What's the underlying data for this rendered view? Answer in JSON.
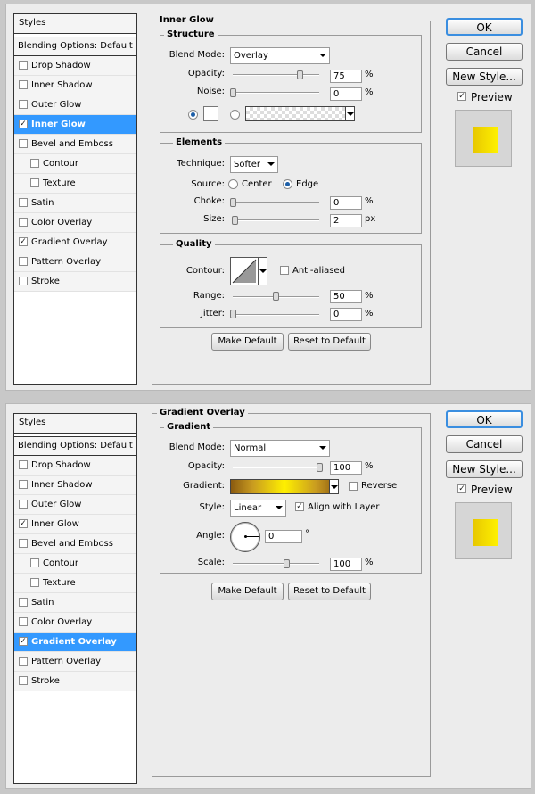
{
  "styles_list": {
    "header": "Styles",
    "blending": "Blending Options: Default",
    "items": [
      "Drop Shadow",
      "Inner Shadow",
      "Outer Glow",
      "Inner Glow",
      "Bevel and Emboss",
      "Contour",
      "Texture",
      "Satin",
      "Color Overlay",
      "Gradient Overlay",
      "Pattern Overlay",
      "Stroke"
    ]
  },
  "buttons": {
    "ok": "OK",
    "cancel": "Cancel",
    "new_style": "New Style...",
    "preview": "Preview",
    "make_default": "Make Default",
    "reset_default": "Reset to Default"
  },
  "inner_glow": {
    "title": "Inner Glow",
    "structure": {
      "title": "Structure",
      "blend_mode_label": "Blend Mode:",
      "blend_mode": "Overlay",
      "opacity_label": "Opacity:",
      "opacity": "75",
      "noise_label": "Noise:",
      "noise": "0",
      "pct": "%"
    },
    "elements": {
      "title": "Elements",
      "technique_label": "Technique:",
      "technique": "Softer",
      "source_label": "Source:",
      "center": "Center",
      "edge": "Edge",
      "choke_label": "Choke:",
      "choke": "0",
      "size_label": "Size:",
      "size": "2",
      "px": "px"
    },
    "quality": {
      "title": "Quality",
      "contour_label": "Contour:",
      "anti_aliased": "Anti-aliased",
      "range_label": "Range:",
      "range": "50",
      "jitter_label": "Jitter:",
      "jitter": "0"
    }
  },
  "gradient_overlay": {
    "title": "Gradient Overlay",
    "gradient": {
      "title": "Gradient",
      "blend_mode_label": "Blend Mode:",
      "blend_mode": "Normal",
      "opacity_label": "Opacity:",
      "opacity": "100",
      "gradient_label": "Gradient:",
      "reverse": "Reverse",
      "style_label": "Style:",
      "style": "Linear",
      "align": "Align with Layer",
      "angle_label": "Angle:",
      "angle": "0",
      "degree": "°",
      "scale_label": "Scale:",
      "scale": "100"
    }
  },
  "colors": {
    "selection": "#3399ff",
    "gold_dark": "#8a5a10",
    "gold_light": "#fff000"
  }
}
